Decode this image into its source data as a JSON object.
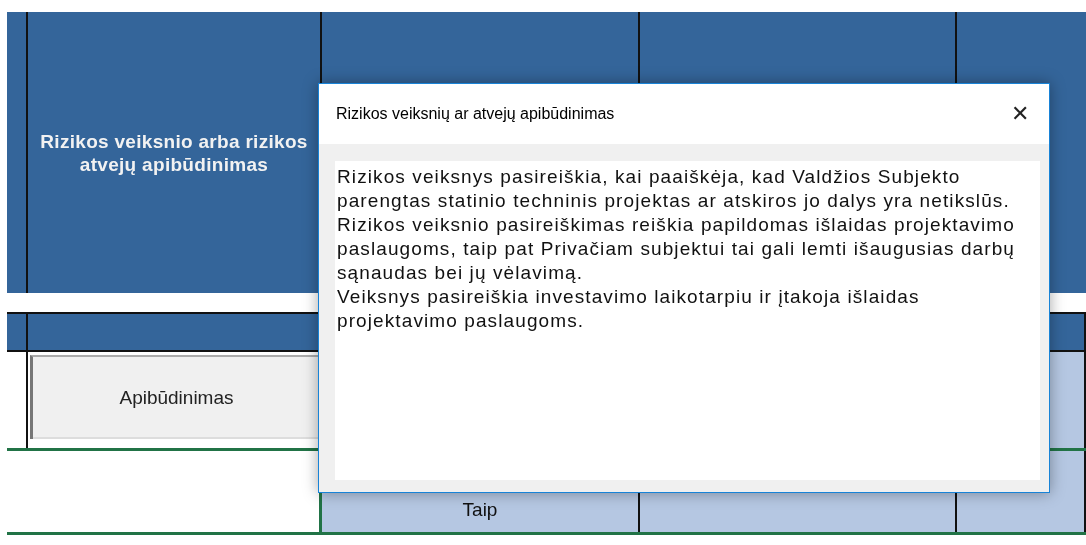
{
  "sheet": {
    "header": {
      "title": "Rizikos veiksnio arba rizikos atvejų apibūdinimas"
    },
    "button": {
      "label": "Apibūdinimas"
    },
    "cell": {
      "value": "Taip"
    }
  },
  "dialog": {
    "title": "Rizikos veiksnių ar atvejų apibūdinimas",
    "close": "✕",
    "text": [
      "Rizikos veiksnys pasireiškia, kai paaiškėja, kad Valdžios Subjekto parengtas statinio techninis projektas ar atskiros jo dalys yra netikslūs.",
      "Rizikos veiksnio pasireiškimas reiškia papildomas išlaidas projektavimo paslaugoms, taip pat Privačiam subjektui tai gali lemti išaugusias darbų sąnaudas bei jų vėlavimą.",
      "Veiksnys pasireiškia investavimo laikotarpiu ir įtakoja išlaidas projektavimo paslaugoms."
    ]
  }
}
